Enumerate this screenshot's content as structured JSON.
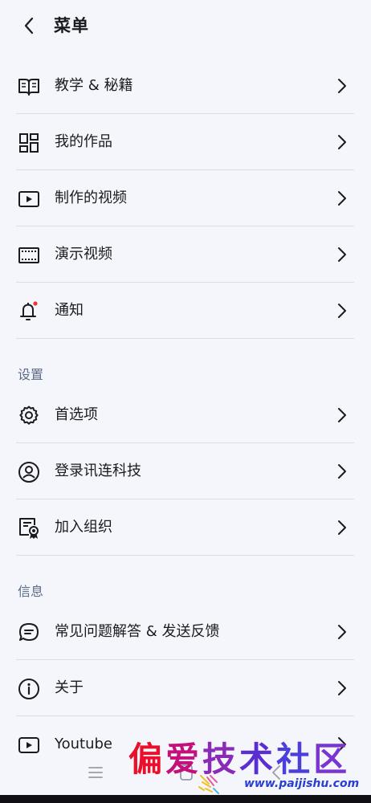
{
  "header": {
    "title": "菜单"
  },
  "menu": {
    "items": [
      {
        "label": "教学 & 秘籍",
        "icon": "book-icon"
      },
      {
        "label": "我的作品",
        "icon": "grid-icon"
      },
      {
        "label": "制作的视频",
        "icon": "video-play-icon"
      },
      {
        "label": "演示视频",
        "icon": "film-icon"
      },
      {
        "label": "通知",
        "icon": "bell-icon"
      }
    ]
  },
  "settings": {
    "heading": "设置",
    "items": [
      {
        "label": "首选项",
        "icon": "gear-icon"
      },
      {
        "label": "登录讯连科技",
        "icon": "user-circle-icon"
      },
      {
        "label": "加入组织",
        "icon": "certificate-icon"
      }
    ]
  },
  "info": {
    "heading": "信息",
    "items": [
      {
        "label": "常见问题解答 & 发送反馈",
        "icon": "chat-icon"
      },
      {
        "label": "关于",
        "icon": "info-icon"
      },
      {
        "label": "Youtube",
        "icon": "youtube-icon"
      }
    ]
  },
  "watermark": {
    "text": "偏爱技术社区",
    "url": "www.paijishu.com"
  },
  "colors": {
    "background": "#f5f6fb",
    "text": "#1b1b1f",
    "section_heading": "#5a6b86",
    "divider": "#dcdde3",
    "notification_dot": "#e53935"
  }
}
